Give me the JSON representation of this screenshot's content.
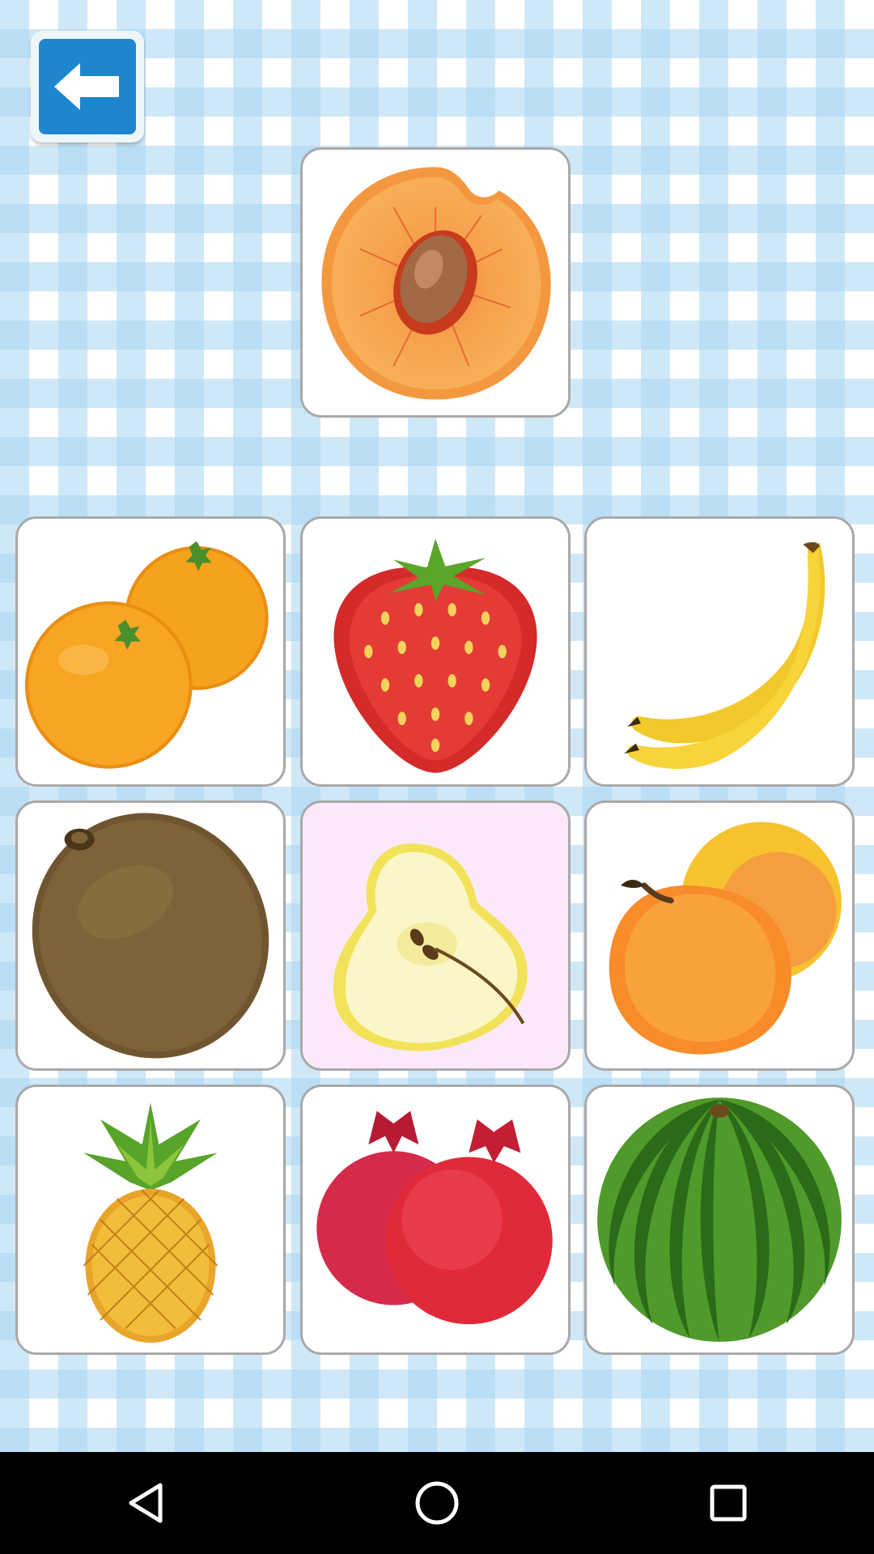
{
  "back_button": {
    "icon": "arrow-left-icon",
    "color": "#1e86cf"
  },
  "target": {
    "fruit": "peach-half",
    "icon": "peach-half-icon"
  },
  "choices": [
    {
      "fruit": "oranges",
      "icon": "oranges-icon",
      "highlighted": false
    },
    {
      "fruit": "strawberry",
      "icon": "strawberry-icon",
      "highlighted": false
    },
    {
      "fruit": "bananas",
      "icon": "bananas-icon",
      "highlighted": false
    },
    {
      "fruit": "kiwi",
      "icon": "kiwi-icon",
      "highlighted": false
    },
    {
      "fruit": "pear-half",
      "icon": "pear-half-icon",
      "highlighted": true
    },
    {
      "fruit": "peaches",
      "icon": "peaches-icon",
      "highlighted": false
    },
    {
      "fruit": "pineapple",
      "icon": "pineapple-icon",
      "highlighted": false
    },
    {
      "fruit": "pomegranates",
      "icon": "pomegranates-icon",
      "highlighted": false
    },
    {
      "fruit": "watermelon",
      "icon": "watermelon-icon",
      "highlighted": false
    }
  ],
  "navigation_bar": {
    "buttons": [
      {
        "name": "back",
        "icon": "triangle-back-icon"
      },
      {
        "name": "home",
        "icon": "circle-home-icon"
      },
      {
        "name": "recents",
        "icon": "square-recents-icon"
      }
    ]
  }
}
